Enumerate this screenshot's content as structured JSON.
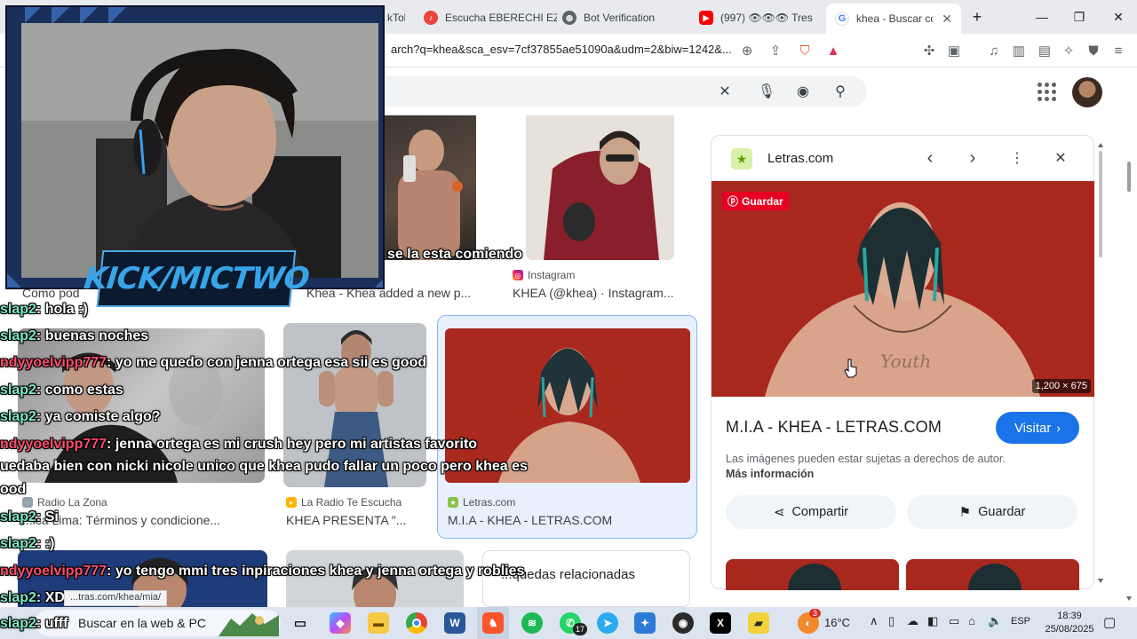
{
  "tabs": [
    {
      "label": "kTok",
      "active": false
    },
    {
      "label": "Escucha EBERECHI EZ",
      "active": false
    },
    {
      "label": "Bot Verification",
      "active": false
    },
    {
      "label": "(997) 👁👁👁 Tres c",
      "active": false
    },
    {
      "label": "khea - Buscar con",
      "active": true
    }
  ],
  "browser": {
    "url": "arch?q=khea&sca_esv=7cf37855ae51090a&udm=2&biw=1242&..."
  },
  "results": [
    {
      "source": "",
      "caption": "Como pod"
    },
    {
      "source": "",
      "caption": "Khea - Khea added a new p..."
    },
    {
      "source": "Instagram",
      "caption": "KHEA (@khea) · Instagram..."
    },
    {
      "source": "Radio La Zona",
      "caption": "...ica Lima: Términos y condicione..."
    },
    {
      "source": "La Radio Te Escucha",
      "caption": "KHEA PRESENTA \"..."
    },
    {
      "source": "Letras.com",
      "caption": "M.I.A - KHEA - LETRAS.COM"
    }
  ],
  "related_label": "...quedas relacionadas",
  "side_panel": {
    "site": "Letras.com",
    "pin_label": "Guardar",
    "dimensions": "1,200 × 675",
    "title": "M.I.A - KHEA - LETRAS.COM",
    "visit_label": "Visitar",
    "copyright_text": "Las imágenes pueden estar sujetas a derechos de autor.",
    "copyright_link": "Más información",
    "share_label": "Compartir",
    "save_label": "Guardar"
  },
  "overlay": {
    "kick_label": "KICK/MICTWO",
    "caption": "se la esta comiendo"
  },
  "chat": [
    {
      "user": "slap2",
      "msg": ": hola :)",
      "color": "#7ee8c8"
    },
    {
      "user": "slap2",
      "msg": ": buenas noches",
      "color": "#7ee8c8"
    },
    {
      "user": "ndyyoelvipp777",
      "msg": ": yo me quedo con jenna ortega esa sii es good",
      "color": "#ff4d6d"
    },
    {
      "user": "slap2",
      "msg": ": como estas",
      "color": "#7ee8c8"
    },
    {
      "user": "slap2",
      "msg": ": ya comiste algo?",
      "color": "#7ee8c8"
    },
    {
      "user": "ndyyoelvipp777",
      "msg": ": jenna ortega es mi crush hey pero mi artistas favorito",
      "color": "#ff4d6d"
    },
    {
      "user": "",
      "msg": "uedaba bien con nicki nicole unico que khea pudo fallar un poco pero khea es",
      "color": "#ffffff"
    },
    {
      "user": "",
      "msg": "ood",
      "color": "#ffffff"
    },
    {
      "user": "slap2",
      "msg": ": Si",
      "color": "#7ee8c8"
    },
    {
      "user": "slap2",
      "msg": ": :)",
      "color": "#7ee8c8"
    },
    {
      "user": "ndyyoelvipp777",
      "msg": ": yo tengo mmi tres inpiraciones khea y jenna ortega y roblies",
      "color": "#ff4d6d"
    },
    {
      "user": "slap2",
      "msg": ": XD",
      "color": "#7ee8c8"
    },
    {
      "user": "slap2",
      "msg": ": ufff",
      "color": "#7ee8c8"
    }
  ],
  "status_url": "...tras.com/khea/mia/",
  "taskbar": {
    "search_placeholder": "Buscar en la web & PC",
    "whatsapp_badge": "17",
    "weather_badge": "3",
    "temperature": "16°C",
    "language": "ESP",
    "time": "18:39",
    "date": "25/08/2025"
  },
  "colors": {
    "accent": "#1a73e8",
    "pinterest": "#e60023",
    "kick_blue": "#38a4e8",
    "chat_user_green": "#7ee8c8",
    "chat_user_red": "#ff4d6d"
  }
}
